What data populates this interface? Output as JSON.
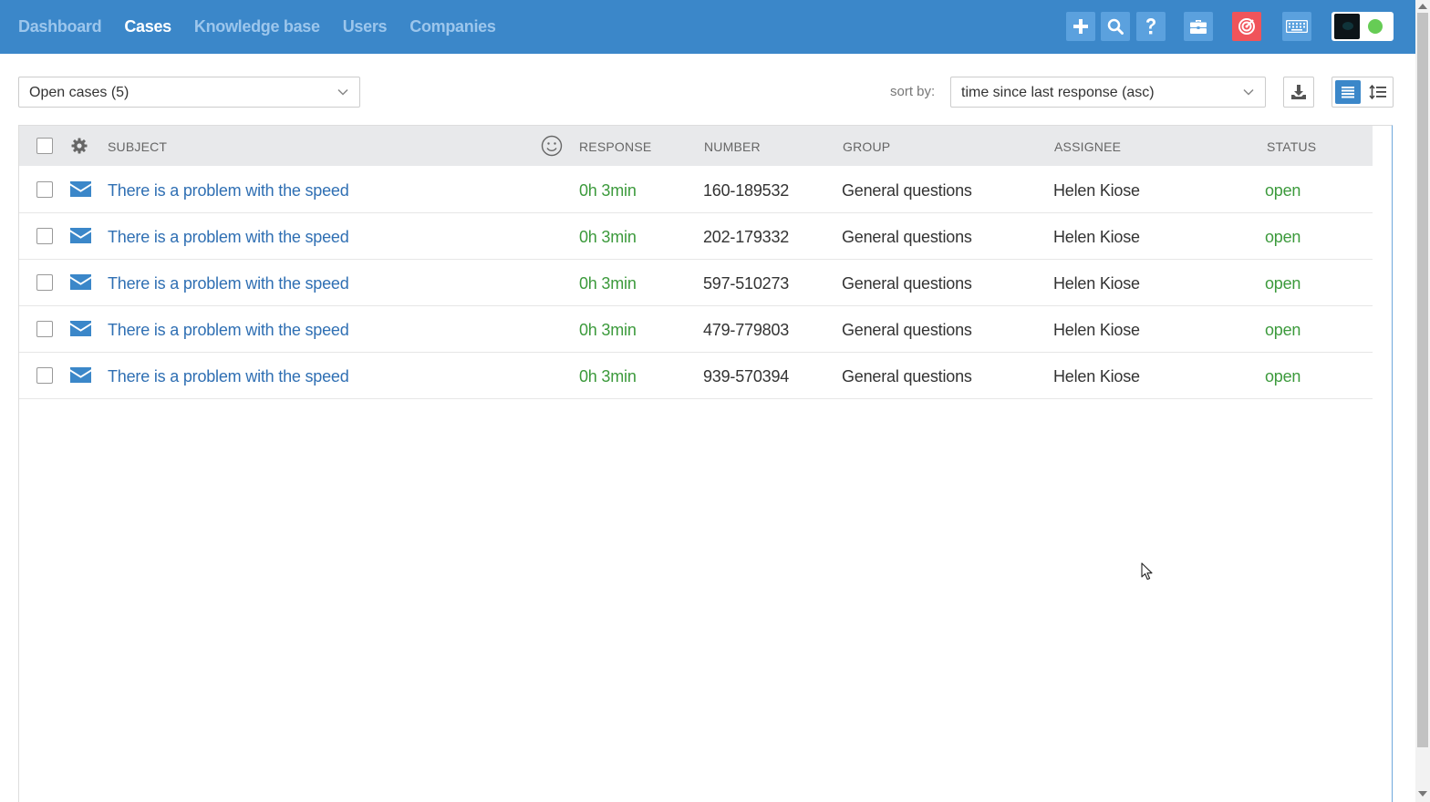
{
  "nav": {
    "items": [
      {
        "label": "Dashboard",
        "active": false
      },
      {
        "label": "Cases",
        "active": true
      },
      {
        "label": "Knowledge base",
        "active": false
      },
      {
        "label": "Users",
        "active": false
      },
      {
        "label": "Companies",
        "active": false
      }
    ]
  },
  "header_buttons": [
    "plus-icon",
    "search-icon",
    "question-icon",
    "briefcase-icon",
    "target-icon",
    "keyboard-icon"
  ],
  "user": {
    "status": "online",
    "status_color": "#66cc55"
  },
  "filter": {
    "selected": "Open cases (5)"
  },
  "sort": {
    "label": "sort by:",
    "selected": "time since last response (asc)"
  },
  "table": {
    "columns": {
      "subject": "SUBJECT",
      "response": "RESPONSE",
      "number": "NUMBER",
      "group": "GROUP",
      "assignee": "ASSIGNEE",
      "status": "STATUS"
    },
    "rows": [
      {
        "subject": "There is a problem with the speed",
        "response": "0h 3min",
        "number": "160-189532",
        "group": "General questions",
        "assignee": "Helen Kiose",
        "status": "open"
      },
      {
        "subject": "There is a problem with the speed",
        "response": "0h 3min",
        "number": "202-179332",
        "group": "General questions",
        "assignee": "Helen Kiose",
        "status": "open"
      },
      {
        "subject": "There is a problem with the speed",
        "response": "0h 3min",
        "number": "597-510273",
        "group": "General questions",
        "assignee": "Helen Kiose",
        "status": "open"
      },
      {
        "subject": "There is a problem with the speed",
        "response": "0h 3min",
        "number": "479-779803",
        "group": "General questions",
        "assignee": "Helen Kiose",
        "status": "open"
      },
      {
        "subject": "There is a problem with the speed",
        "response": "0h 3min",
        "number": "939-570394",
        "group": "General questions",
        "assignee": "Helen Kiose",
        "status": "open"
      }
    ]
  },
  "colors": {
    "brand": "#3b87c9",
    "link": "#2f6fb3",
    "status_open": "#3c9a3c",
    "alert": "#f0545a"
  }
}
